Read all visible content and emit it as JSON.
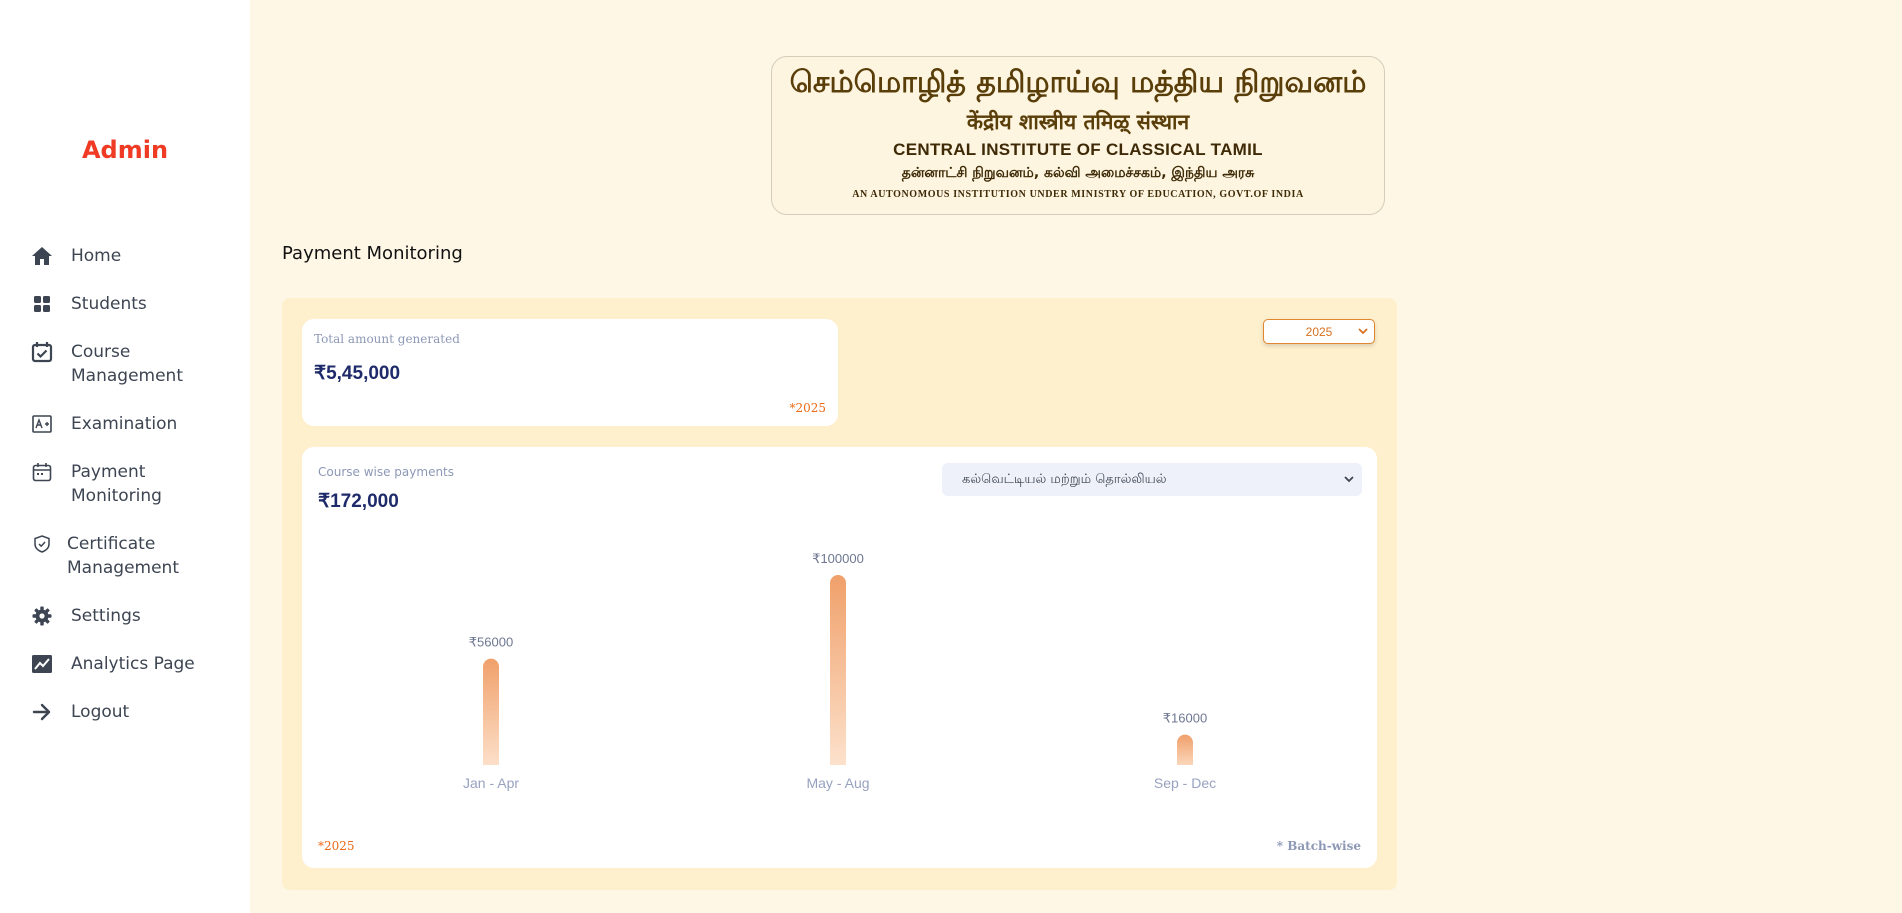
{
  "sidebar": {
    "brand": "Admin",
    "items": [
      {
        "label": "Home",
        "icon": "home-icon"
      },
      {
        "label": "Students",
        "icon": "grid-icon"
      },
      {
        "label": "Course Management",
        "icon": "calendar-check-icon"
      },
      {
        "label": "Examination",
        "icon": "grade-icon"
      },
      {
        "label": "Payment Monitoring",
        "icon": "calendar-icon"
      },
      {
        "label": "Certificate Management",
        "icon": "shield-check-icon"
      },
      {
        "label": "Settings",
        "icon": "gear-icon"
      },
      {
        "label": "Analytics Page",
        "icon": "chart-line-icon"
      },
      {
        "label": "Logout",
        "icon": "arrow-right-icon"
      }
    ]
  },
  "logo": {
    "line1": "செம்மொழித் தமிழாய்வு மத்திய நிறுவனம்",
    "line2": "केंद्रीय  शास्त्रीय तमिऴ् संस्थान",
    "line3": "CENTRAL INSTITUTE OF CLASSICAL TAMIL",
    "line4": "தன்னாட்சி நிறுவனம், கல்வி அமைச்சகம், இந்திய அரசு",
    "line5": "AN AUTONOMOUS INSTITUTION UNDER MINISTRY OF EDUCATION, GOVT.OF INDIA"
  },
  "page": {
    "title": "Payment Monitoring"
  },
  "year_select": {
    "value": "2025"
  },
  "total_card": {
    "label": "Total amount generated",
    "value": "₹5,45,000",
    "note": "*2025"
  },
  "course_card": {
    "label": "Course wise payments",
    "value": "₹172,000",
    "course_select": "கல்வெட்டியல் மற்றும் தொல்லியல்",
    "note_left": "*2025",
    "note_right": "* Batch-wise"
  },
  "chart_data": {
    "type": "bar",
    "categories": [
      "Jan - Apr",
      "May - Aug",
      "Sep - Dec"
    ],
    "values": [
      56000,
      100000,
      16000
    ],
    "value_labels": [
      "₹56000",
      "₹100000",
      "₹16000"
    ],
    "ylim": [
      0,
      100000
    ],
    "colors": {
      "bar_top": "#f0a06a",
      "bar_bottom": "#fde4d0",
      "tick": "#98a2c0",
      "value_label": "#6d7791"
    }
  }
}
